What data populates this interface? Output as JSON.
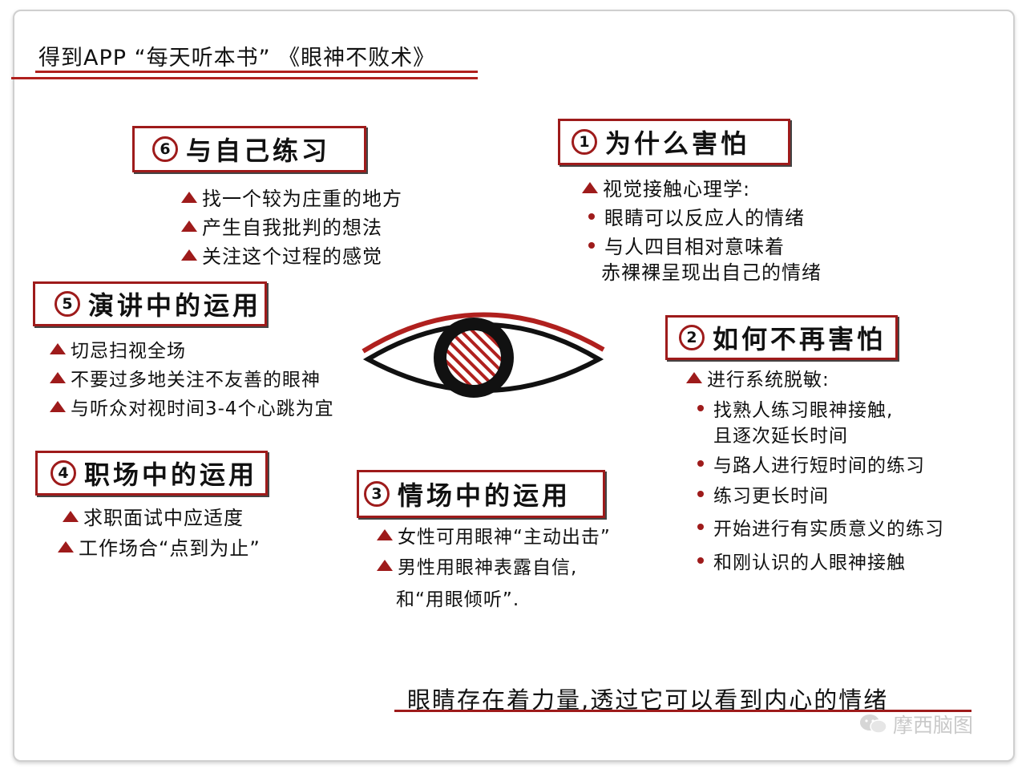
{
  "header": {
    "title": "得到APP “每天听本书” 《眼神不败术》"
  },
  "sections": [
    {
      "num": "1",
      "title": "为什么害怕",
      "sub": "视觉接触心理学:",
      "items": [
        "眼睛可以反应人的情绪",
        "与人四目相对意味着"
      ],
      "cont": "赤裸裸呈现出自己的情绪"
    },
    {
      "num": "2",
      "title": "如何不再害怕",
      "sub": "进行系统脱敏:",
      "items": [
        "找熟人练习眼神接触,",
        "与路人进行短时间的练习",
        "练习更长时间",
        "开始进行有实质意义的练习",
        "和刚认识的人眼神接触"
      ],
      "cont": "且逐次延长时间"
    },
    {
      "num": "3",
      "title": "情场中的运用",
      "items": [
        "女性可用眼神“主动出击”",
        "男性用眼神表露自信,"
      ],
      "cont": "和“用眼倾听”."
    },
    {
      "num": "4",
      "title": "职场中的运用",
      "items": [
        "求职面试中应适度",
        "工作场合“点到为止”"
      ]
    },
    {
      "num": "5",
      "title": "演讲中的运用",
      "items": [
        "切忌扫视全场",
        "不要过多地关注不友善的眼神",
        "与听众对视时间3-4个心跳为宜"
      ]
    },
    {
      "num": "6",
      "title": "与自己练习",
      "items": [
        "找一个较为庄重的地方",
        "产生自我批判的想法",
        "关注这个过程的感觉"
      ]
    }
  ],
  "quote": "眼睛存在着力量,透过它可以看到内心的情绪",
  "watermark": "摩西脑图",
  "colors": {
    "accent": "#9e1b1b",
    "text": "#111111"
  }
}
